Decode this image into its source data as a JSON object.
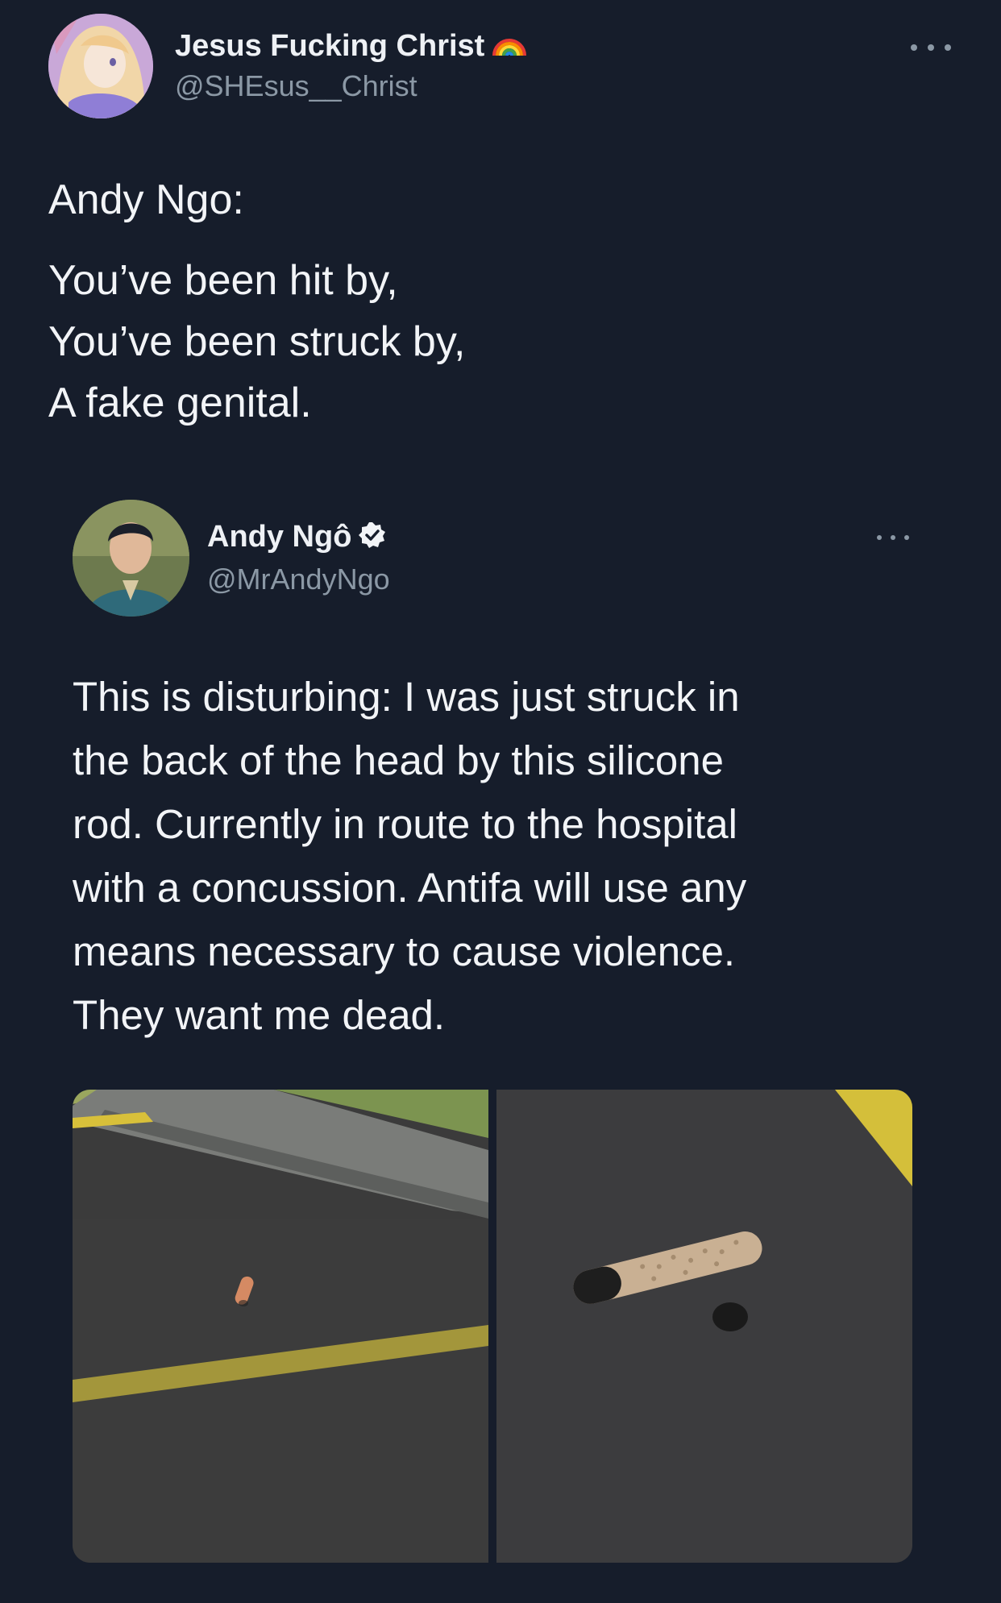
{
  "tweet": {
    "display_name": "Jesus Fucking Christ",
    "name_emoji": "rainbow-icon",
    "handle": "@SHEsus__Christ",
    "text_lines": {
      "line1": "Andy Ngo:",
      "line2": "You’ve been hit by,",
      "line3": "You’ve been struck by,",
      "line4": "A fake genital."
    }
  },
  "quoted_tweet": {
    "display_name": "Andy Ngô",
    "verified_icon": "verified-badge-icon",
    "handle": "@MrAndyNgo",
    "text_lines": {
      "line1": "This is disturbing: I was just struck in",
      "line2": "the back of the head by this silicone",
      "line3": "rod. Currently in route to the hospital",
      "line4": "with a concussion. Antifa will use any",
      "line5": "means necessary to cause violence.",
      "line6": "They want me dead."
    }
  },
  "colors": {
    "background": "#161d2b",
    "primary_text": "#e7e9ea",
    "secondary_text": "#8b98a5",
    "verified": "#ffffff"
  }
}
